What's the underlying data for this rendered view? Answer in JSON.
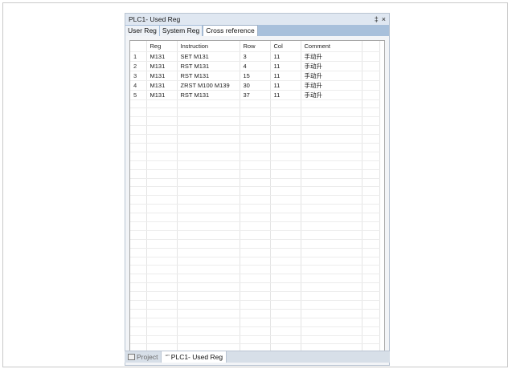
{
  "window": {
    "title": "PLC1- Used Reg",
    "pin_glyph": "‡",
    "close_glyph": "×"
  },
  "tabs": [
    {
      "label": "User Reg"
    },
    {
      "label": "System Reg"
    },
    {
      "label": "Cross reference"
    }
  ],
  "table": {
    "columns": [
      "",
      "Reg",
      "Instruction",
      "Row",
      "Col",
      "Comment"
    ],
    "rows": [
      [
        "1",
        "M131",
        "SET M131",
        "3",
        "11",
        "手动升"
      ],
      [
        "2",
        "M131",
        "RST M131",
        "4",
        "11",
        "手动升"
      ],
      [
        "3",
        "M131",
        "RST M131",
        "15",
        "11",
        "手动升"
      ],
      [
        "4",
        "M131",
        "ZRST M100 M139",
        "30",
        "11",
        "手动升"
      ],
      [
        "5",
        "M131",
        "RST M131",
        "37",
        "11",
        "手动升"
      ]
    ],
    "empty_rows": 29
  },
  "bottom_tabs": [
    {
      "label": "Project",
      "icon": "project-icon"
    },
    {
      "label": "PLC1- Used Reg",
      "icon": "register-icon"
    }
  ]
}
